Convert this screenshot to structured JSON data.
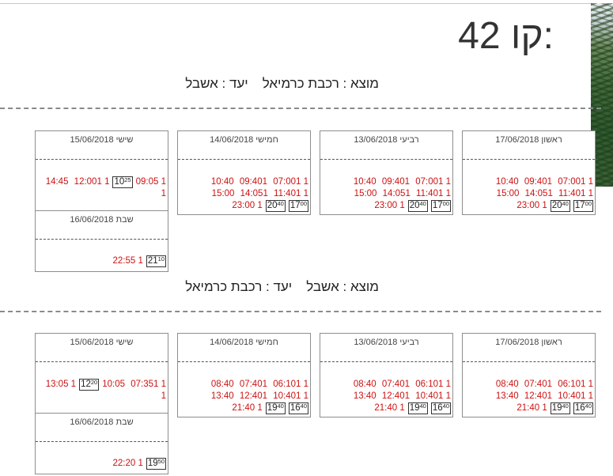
{
  "title": "קו 42:",
  "routes": [
    {
      "from": "מוצא : רכבת כרמיאל",
      "to": "יעד : אשבל",
      "days": [
        {
          "day": "ראשון 17/06/2018",
          "lines": [
            {
              "times": [
                "07:00",
                "09:40",
                "10:40"
              ]
            },
            {
              "times": [
                "11:40",
                "14:05",
                "15:00"
              ]
            },
            {
              "boxed": [
                {
                  "h": "17",
                  "m": "00"
                },
                {
                  "h": "20",
                  "m": "40"
                }
              ],
              "times": [
                "23:00"
              ]
            }
          ]
        },
        {
          "day": "רביעי 13/06/2018",
          "lines": [
            {
              "times": [
                "07:00",
                "09:40",
                "10:40"
              ]
            },
            {
              "times": [
                "11:40",
                "14:05",
                "15:00"
              ]
            },
            {
              "boxed": [
                {
                  "h": "17",
                  "m": "00"
                },
                {
                  "h": "20",
                  "m": "40"
                }
              ],
              "times": [
                "23:00"
              ]
            }
          ]
        },
        {
          "day": "חמישי 14/06/2018",
          "lines": [
            {
              "times": [
                "07:00",
                "09:40",
                "10:40"
              ]
            },
            {
              "times": [
                "11:40",
                "14:05",
                "15:00"
              ]
            },
            {
              "boxed": [
                {
                  "h": "17",
                  "m": "00"
                },
                {
                  "h": "20",
                  "m": "40"
                }
              ],
              "times": [
                "23:00"
              ]
            }
          ]
        },
        {
          "day": "שישי 15/06/2018",
          "lines": [
            {
              "times": [
                "09:05"
              ],
              "boxed": [
                {
                  "h": "10",
                  "m": "25"
                }
              ],
              "times2": [
                "12:00",
                "14:45"
              ]
            },
            {
              "marker": "1"
            }
          ]
        },
        {
          "day": "שבת 16/06/2018",
          "lines": [
            {
              "boxed": [
                {
                  "h": "21",
                  "m": "10"
                }
              ],
              "times": [
                "22:55"
              ]
            }
          ]
        }
      ]
    },
    {
      "from": "מוצא : אשבל",
      "to": "יעד : רכבת כרמיאל",
      "days": [
        {
          "day": "ראשון 17/06/2018",
          "lines": [
            {
              "times": [
                "06:10",
                "07:40",
                "08:40"
              ]
            },
            {
              "times": [
                "10:40",
                "12:40",
                "13:40"
              ]
            },
            {
              "boxed": [
                {
                  "h": "16",
                  "m": "40"
                },
                {
                  "h": "19",
                  "m": "40"
                }
              ],
              "times": [
                "21:40"
              ]
            }
          ]
        },
        {
          "day": "רביעי 13/06/2018",
          "lines": [
            {
              "times": [
                "06:10",
                "07:40",
                "08:40"
              ]
            },
            {
              "times": [
                "10:40",
                "12:40",
                "13:40"
              ]
            },
            {
              "boxed": [
                {
                  "h": "16",
                  "m": "40"
                },
                {
                  "h": "19",
                  "m": "40"
                }
              ],
              "times": [
                "21:40"
              ]
            }
          ]
        },
        {
          "day": "חמישי 14/06/2018",
          "lines": [
            {
              "times": [
                "06:10",
                "07:40",
                "08:40"
              ]
            },
            {
              "times": [
                "10:40",
                "12:40",
                "13:40"
              ]
            },
            {
              "boxed": [
                {
                  "h": "16",
                  "m": "40"
                },
                {
                  "h": "19",
                  "m": "40"
                }
              ],
              "times": [
                "21:40"
              ]
            }
          ]
        },
        {
          "day": "שישי 15/06/2018",
          "lines": [
            {
              "times": [
                "07:35",
                "10:05"
              ],
              "boxed": [
                {
                  "h": "12",
                  "m": "20"
                }
              ],
              "times2": [
                "13:05"
              ]
            },
            {
              "marker": "1"
            }
          ]
        },
        {
          "day": "שבת 16/06/2018",
          "lines": [
            {
              "boxed": [
                {
                  "h": "19",
                  "m": "50"
                }
              ],
              "times": [
                "22:20"
              ]
            }
          ]
        }
      ]
    }
  ],
  "marker": "1"
}
